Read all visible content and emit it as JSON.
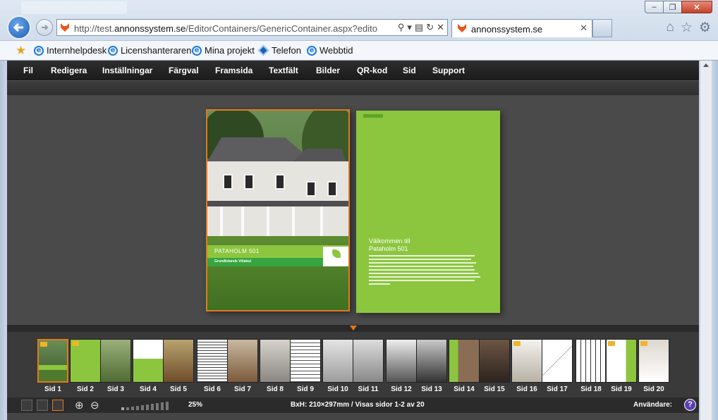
{
  "browser": {
    "url_prefix": "http://test.",
    "url_domain": "annonssystem.se",
    "url_rest": "/EditorContainers/GenericContainer.aspx?editorName=p",
    "tab_title": "annonssystem.se",
    "window_buttons": [
      "–",
      "❐",
      "✕"
    ],
    "favorites": [
      "Internhelpdesk",
      "Licenshanteraren",
      "Mina projekt",
      "Telefon",
      "Webbtid"
    ]
  },
  "menu": [
    "Fil",
    "Redigera",
    "Inställningar",
    "Färgval",
    "Framsida",
    "Textfält",
    "Bilder",
    "QR-kod",
    "Sid",
    "Support"
  ],
  "pages": {
    "cover_title": "PATAHOLM 501",
    "cover_subtitle": "Grundlotande Villabut",
    "welcome_line1": "Välkommen till",
    "welcome_line2": "Pataholm 501"
  },
  "thumbnails": [
    {
      "label": "Sid 1",
      "locked": true,
      "active": true
    },
    {
      "label": "Sid 2",
      "locked": true
    },
    {
      "label": "Sid 3"
    },
    {
      "label": "Sid 4"
    },
    {
      "label": "Sid 5"
    },
    {
      "label": "Sid 6"
    },
    {
      "label": "Sid 7"
    },
    {
      "label": "Sid 8"
    },
    {
      "label": "Sid 9"
    },
    {
      "label": "Sid 10"
    },
    {
      "label": "Sid 11"
    },
    {
      "label": "Sid 12"
    },
    {
      "label": "Sid 13"
    },
    {
      "label": "Sid 14"
    },
    {
      "label": "Sid 15"
    },
    {
      "label": "Sid 16",
      "locked": true
    },
    {
      "label": "Sid 17"
    },
    {
      "label": "Sid 18"
    },
    {
      "label": "Sid 19",
      "locked": true
    },
    {
      "label": "Sid 20",
      "locked": true
    }
  ],
  "status": {
    "zoom": "25%",
    "dimensions": "BxH: 210×297mm  /  Visas sidor 1-2 av 20",
    "user_label": "Användare:",
    "help": "?"
  },
  "colors": {
    "accent": "#e07a1f",
    "brand_green": "#8cc63f"
  }
}
